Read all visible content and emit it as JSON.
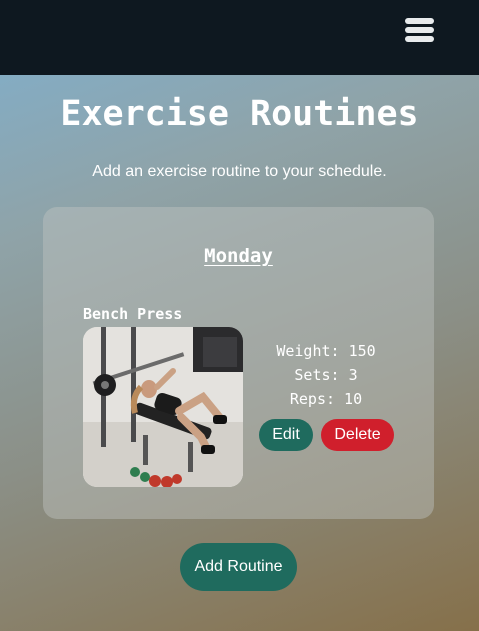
{
  "header": {
    "menu_icon": "hamburger-menu-icon"
  },
  "page": {
    "title": "Exercise Routines",
    "subtitle": "Add an exercise routine to your schedule."
  },
  "days": [
    {
      "day": "Monday",
      "exercises": [
        {
          "name": "Bench Press",
          "photo": "bench-press-photo",
          "weight_text": "Weight: 150",
          "sets_text": "Sets: 3",
          "reps_text": "Reps: 10",
          "edit_label": "Edit",
          "delete_label": "Delete"
        }
      ]
    }
  ],
  "actions": {
    "add_routine_label": "Add Routine"
  },
  "colors": {
    "topbar": "#0e1820",
    "primary_button": "#1f6b5e",
    "danger_button": "#d01f2c"
  }
}
